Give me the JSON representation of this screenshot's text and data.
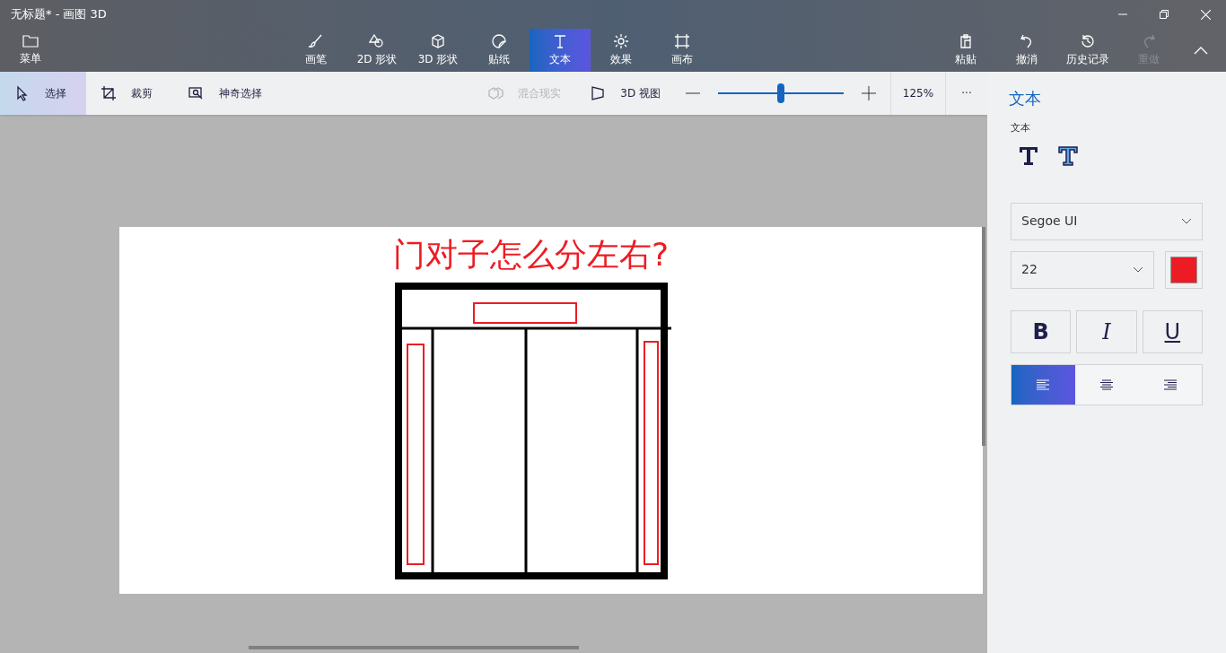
{
  "window": {
    "title": "无标题* - 画图 3D"
  },
  "menu": {
    "label": "菜单"
  },
  "tools": [
    {
      "label": "画笔",
      "kind": "brush",
      "selected": false
    },
    {
      "label": "2D 形状",
      "kind": "shape2d",
      "selected": false
    },
    {
      "label": "3D 形状",
      "kind": "shape3d",
      "selected": false
    },
    {
      "label": "贴纸",
      "kind": "sticker",
      "selected": false
    },
    {
      "label": "文本",
      "kind": "text",
      "selected": true
    },
    {
      "label": "效果",
      "kind": "effects",
      "selected": false
    },
    {
      "label": "画布",
      "kind": "canvas",
      "selected": false
    }
  ],
  "actions": [
    {
      "label": "粘贴",
      "kind": "paste",
      "disabled": false
    },
    {
      "label": "撤消",
      "kind": "undo",
      "disabled": false
    },
    {
      "label": "历史记录",
      "kind": "history",
      "disabled": false
    },
    {
      "label": "重做",
      "kind": "redo",
      "disabled": true
    }
  ],
  "subtools": [
    {
      "label": "选择",
      "kind": "select",
      "selected": true,
      "disabled": false
    },
    {
      "label": "裁剪",
      "kind": "crop",
      "selected": false,
      "disabled": false
    },
    {
      "label": "神奇选择",
      "kind": "magic",
      "selected": false,
      "disabled": false
    }
  ],
  "view_tools": [
    {
      "label": "混合现实",
      "kind": "mixed",
      "disabled": true
    },
    {
      "label": "3D 视图",
      "kind": "view3d",
      "disabled": false
    }
  ],
  "zoom": {
    "level": 0.5,
    "reading": "125%",
    "more": "···"
  },
  "canvas": {
    "heading": "门对子怎么分左右?"
  },
  "panel": {
    "title": "文本",
    "section": "文本",
    "font": "Segoe UI",
    "size": "22",
    "color": "#ed1c24",
    "styles": [
      {
        "label": "B",
        "kind": "bold",
        "selected": false
      },
      {
        "label": "I",
        "kind": "italic",
        "selected": false
      },
      {
        "label": "U",
        "kind": "underline",
        "selected": false
      }
    ],
    "align": [
      {
        "kind": "left",
        "selected": true
      },
      {
        "kind": "center",
        "selected": false
      },
      {
        "kind": "right",
        "selected": false
      }
    ]
  }
}
